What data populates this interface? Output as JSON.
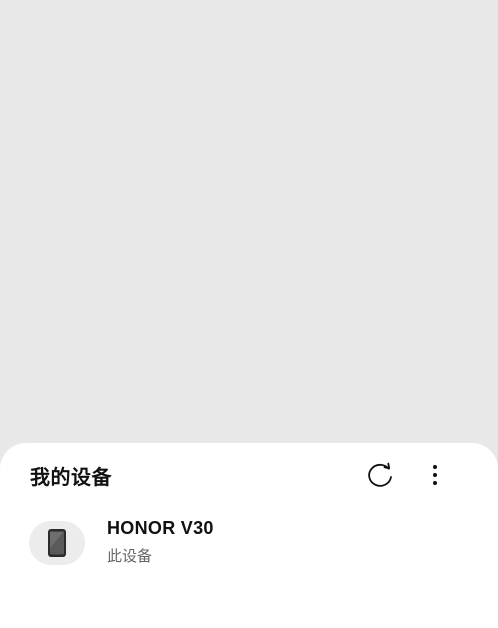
{
  "sheet": {
    "title": "我的设备",
    "refresh_icon": "refresh-icon",
    "more_icon": "more-vertical-icon"
  },
  "devices": [
    {
      "name": "HONOR V30",
      "subtitle": "此设备",
      "icon": "phone-icon"
    }
  ],
  "colors": {
    "backdrop": "#e8e8e8",
    "sheet": "#ffffff",
    "text_primary": "#111111",
    "text_secondary": "#666666"
  }
}
